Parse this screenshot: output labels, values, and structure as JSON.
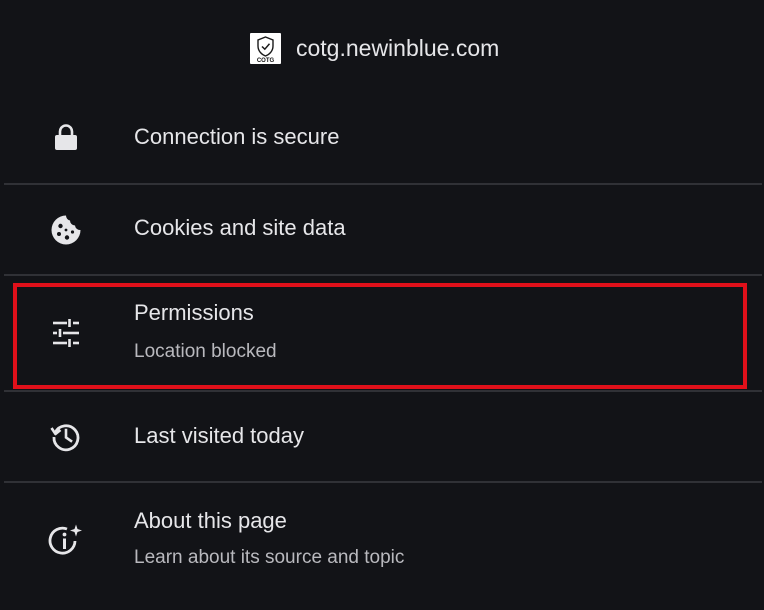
{
  "header": {
    "host": "cotg.newinblue.com",
    "favicon_text": "COTG"
  },
  "items": [
    {
      "title": "Connection is secure",
      "icon": "lock-icon"
    },
    {
      "title": "Cookies and site data",
      "icon": "cookie-icon"
    },
    {
      "title": "Permissions",
      "subtitle": "Location blocked",
      "icon": "tune-sliders-icon"
    },
    {
      "title": "Last visited today",
      "icon": "history-icon"
    },
    {
      "title": "About this page",
      "subtitle": "Learn about its source and topic",
      "icon": "info-sparkle-icon"
    }
  ],
  "colors": {
    "background": "#121317",
    "text": "#e6e6e9",
    "subtext": "#b9b9be",
    "divider": "#303136",
    "highlight": "#e0101a"
  }
}
